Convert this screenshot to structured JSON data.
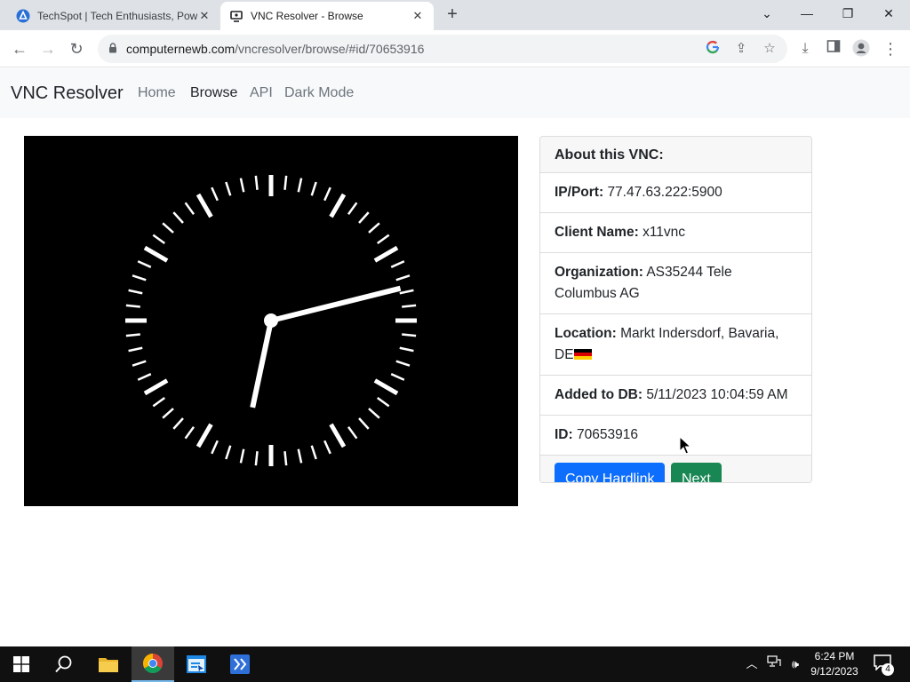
{
  "browser": {
    "tabs": [
      {
        "title": "TechSpot | Tech Enthusiasts, Pow",
        "active": false
      },
      {
        "title": "VNC Resolver - Browse",
        "active": true
      }
    ],
    "new_tab": "+",
    "window_controls": {
      "list": "⌄",
      "minimize": "—",
      "restore": "❐",
      "close": "✕"
    },
    "url_host": "computernewb.com",
    "url_path": "/vncresolver/browse/#id/70653916"
  },
  "nav": {
    "brand": "VNC Resolver",
    "links": [
      {
        "label": "Home",
        "active": false
      },
      {
        "label": "Browse",
        "active": true
      },
      {
        "label": "API",
        "active": false
      },
      {
        "label": "Dark Mode",
        "active": false
      }
    ]
  },
  "card": {
    "header": "About this VNC:",
    "rows": [
      {
        "label": "IP/Port:",
        "value": "77.47.63.222:5900"
      },
      {
        "label": "Client Name:",
        "value": "x11vnc"
      },
      {
        "label": "Organization:",
        "value": "AS35244 Tele Columbus AG"
      },
      {
        "label": "Location:",
        "value": "Markt Indersdorf, Bavaria, DE"
      },
      {
        "label": "Added to DB:",
        "value": "5/11/2023 10:04:59 AM"
      },
      {
        "label": "ID:",
        "value": "70653916"
      }
    ],
    "buttons": {
      "copy": "Copy Hardlink",
      "next": "Next"
    }
  },
  "vnc_screen": {
    "clock": {
      "hour": 2,
      "minute": 32
    }
  },
  "taskbar": {
    "time": "6:24 PM",
    "date": "9/12/2023",
    "notifications": "4"
  },
  "colors": {
    "primary": "#0d6efd",
    "success": "#198754",
    "navbar_bg": "#f8f9fa",
    "taskbar_bg": "#101010"
  }
}
